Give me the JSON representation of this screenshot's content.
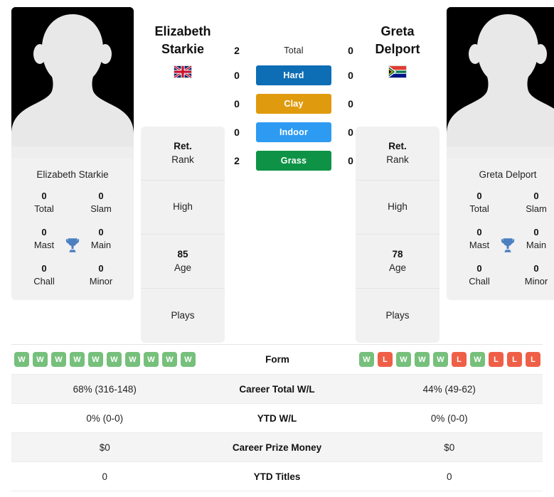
{
  "players": {
    "left": {
      "first_name": "Elizabeth",
      "last_name": "Starkie",
      "full_name": "Elizabeth Starkie",
      "country_flag": "gb-flag-icon",
      "titles": {
        "total_value": "0",
        "total_label": "Total",
        "slam_value": "0",
        "slam_label": "Slam",
        "mast_value": "0",
        "mast_label": "Mast",
        "main_value": "0",
        "main_label": "Main",
        "chall_value": "0",
        "chall_label": "Chall",
        "minor_value": "0",
        "minor_label": "Minor"
      },
      "info": {
        "rank_value": "Ret.",
        "rank_label": "Rank",
        "high_value": "",
        "high_label": "High",
        "age_value": "85",
        "age_label": "Age",
        "plays_value": "",
        "plays_label": "Plays"
      },
      "surface_wins": {
        "total": "2",
        "hard": "0",
        "clay": "0",
        "indoor": "0",
        "grass": "2"
      },
      "form": [
        "W",
        "W",
        "W",
        "W",
        "W",
        "W",
        "W",
        "W",
        "W",
        "W"
      ],
      "career_total_wl": "68% (316-148)",
      "ytd_wl": "0% (0-0)",
      "career_prize_money": "$0",
      "ytd_titles": "0"
    },
    "right": {
      "first_name": "Greta",
      "last_name": "Delport",
      "full_name": "Greta Delport",
      "country_flag": "za-flag-icon",
      "titles": {
        "total_value": "0",
        "total_label": "Total",
        "slam_value": "0",
        "slam_label": "Slam",
        "mast_value": "0",
        "mast_label": "Mast",
        "main_value": "0",
        "main_label": "Main",
        "chall_value": "0",
        "chall_label": "Chall",
        "minor_value": "0",
        "minor_label": "Minor"
      },
      "info": {
        "rank_value": "Ret.",
        "rank_label": "Rank",
        "high_value": "",
        "high_label": "High",
        "age_value": "78",
        "age_label": "Age",
        "plays_value": "",
        "plays_label": "Plays"
      },
      "surface_wins": {
        "total": "0",
        "hard": "0",
        "clay": "0",
        "indoor": "0",
        "grass": "0"
      },
      "form": [
        "W",
        "L",
        "W",
        "W",
        "W",
        "L",
        "W",
        "L",
        "L",
        "L"
      ],
      "career_total_wl": "44% (49-62)",
      "ytd_wl": "0% (0-0)",
      "career_prize_money": "$0",
      "ytd_titles": "0"
    }
  },
  "surfaces": {
    "total_label": "Total",
    "hard_label": "Hard",
    "clay_label": "Clay",
    "indoor_label": "Indoor",
    "grass_label": "Grass"
  },
  "stats_rows": {
    "form_label": "Form",
    "career_total_wl_label": "Career Total W/L",
    "ytd_wl_label": "YTD W/L",
    "career_prize_money_label": "Career Prize Money",
    "ytd_titles_label": "YTD Titles"
  },
  "colors": {
    "hard": "#0d6db5",
    "clay": "#e09a0e",
    "indoor": "#2e9bf2",
    "grass": "#0e9346",
    "win_badge": "#76c07c",
    "loss_badge": "#ef5f47",
    "trophy": "#4a7fc1",
    "card_bg": "#f1f1f1"
  }
}
